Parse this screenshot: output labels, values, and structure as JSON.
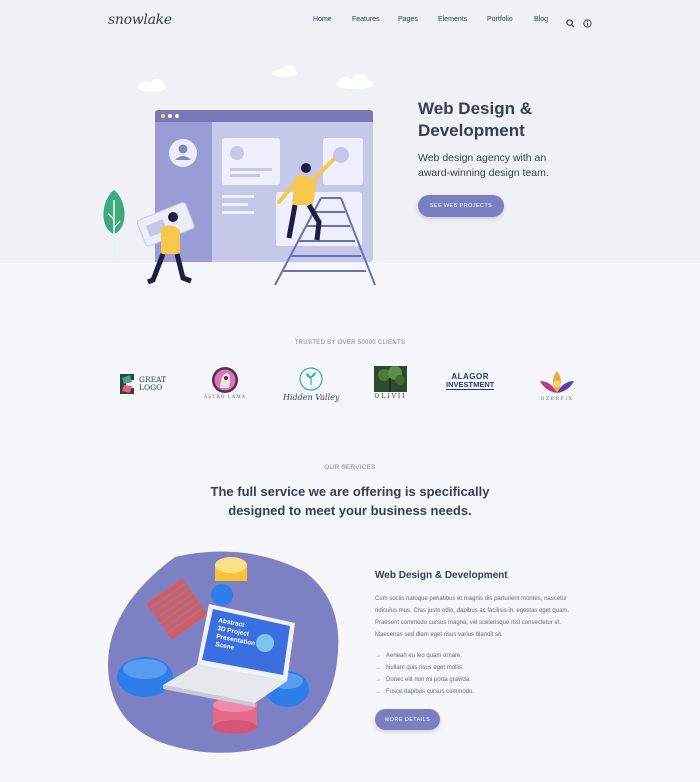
{
  "brand": {
    "logo_text": "snowlake"
  },
  "nav": {
    "items": [
      "Home",
      "Features",
      "Pages",
      "Elements",
      "Portfolio",
      "Blog"
    ]
  },
  "hero": {
    "title_line1": "Web Design &",
    "title_line2": "Development",
    "subtitle_line1": "Web design agency with an",
    "subtitle_line2": "award-winning design team.",
    "button_label": "SEE WEB PROJECTS"
  },
  "clients": {
    "heading": "TRUSTED BY OVER 50000 CLIENTS",
    "logos": [
      {
        "line1": "GREAT",
        "line2": "LOGO"
      },
      {
        "caption": "ASTRO LAMA"
      },
      {
        "caption": "Hidden Valley"
      },
      {
        "caption": "OLIVII"
      },
      {
        "line1": "ALAGOR",
        "line2": "INVESTMENT"
      },
      {
        "caption": "OZERFIX"
      }
    ]
  },
  "services": {
    "label": "OUR SERVICES",
    "headline_line1": "The full service we are offering is specifically",
    "headline_line2": "designed to meet your business needs.",
    "laptop_screen_text": [
      "Abstract",
      "3D Project",
      "Presentation",
      "Scene"
    ],
    "title": "Web Design & Development",
    "body": "Cum sociis natoque penatibus et magnis dis parturient montes, nascetur ridiculus mus. Cras justo odio, dapibus ac facilisis in, egestas eget quam. Praesent commodo cursus magna, vel scelerisque nisl consectetur et. Maecenas sed diam eget risus varius blandit sit.",
    "bullets": [
      "Aenean eu leo quam ornare.",
      "Nullam quis risus eget mollis.",
      "Donec elit non mi porta gravida.",
      "Fusce dapibus cursus commodo."
    ],
    "button_label": "MORE DETAILS"
  },
  "colors": {
    "accent": "#7b7fbf",
    "hero_bg": "#f0f1f5",
    "page_bg": "#f6f7fb",
    "text": "#343f52"
  },
  "icons": [
    "search-icon",
    "info-icon"
  ]
}
